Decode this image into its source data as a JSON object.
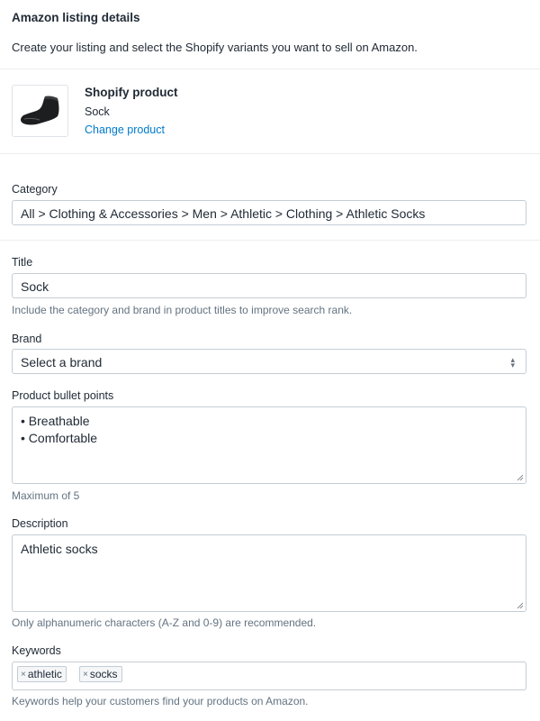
{
  "header": {
    "title": "Amazon listing details",
    "subtitle": "Create your listing and select the Shopify variants you want to sell on Amazon."
  },
  "product": {
    "heading": "Shopify product",
    "name": "Sock",
    "change_link": "Change product"
  },
  "category": {
    "label": "Category",
    "value": "All > Clothing & Accessories > Men > Athletic > Clothing > Athletic Socks"
  },
  "title_field": {
    "label": "Title",
    "value": "Sock",
    "help": "Include the category and brand in product titles to improve search rank."
  },
  "brand": {
    "label": "Brand",
    "selected": "Select a brand"
  },
  "bullets": {
    "label": "Product bullet points",
    "items": [
      "• Breathable",
      "• Comfortable"
    ],
    "help": "Maximum of 5"
  },
  "description": {
    "label": "Description",
    "value": "Athletic socks",
    "help": "Only alphanumeric characters (A-Z and 0-9) are recommended."
  },
  "keywords": {
    "label": "Keywords",
    "tags": [
      "athletic",
      "socks"
    ],
    "remove_glyph": "×",
    "help": "Keywords help your customers find your products on Amazon."
  }
}
